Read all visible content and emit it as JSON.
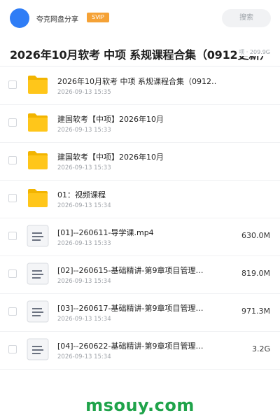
{
  "header": {
    "user_name": "夸克网盘分享",
    "vip_badge": "SVIP",
    "search_placeholder": "搜索"
  },
  "folder": {
    "title": "2026年10月软考 中项 系规课程合集（0912更新）",
    "meta": "项 · 209.9G"
  },
  "colors": {
    "folder": "#ffc61a",
    "accent": "#2f7df6",
    "vip": "#f5a236",
    "brand": "#1fa34a"
  },
  "items": [
    {
      "type": "folder",
      "icon": "folder-icon",
      "name": "2026年10月软考 中项 系规课程合集（0912…",
      "date": "2026-09-13 15:35",
      "size": ""
    },
    {
      "type": "folder",
      "icon": "folder-icon",
      "name": "建国软考【中项】2026年10月",
      "date": "2026-09-13 15:33",
      "size": ""
    },
    {
      "type": "folder",
      "icon": "folder-icon",
      "name": "建国软考【中项】2026年10月",
      "date": "2026-09-13 15:33",
      "size": ""
    },
    {
      "type": "folder",
      "icon": "folder-icon",
      "name": "01：视频课程",
      "date": "2026-09-13 15:34",
      "size": ""
    },
    {
      "type": "file",
      "icon": "document-icon",
      "name": "[01]--260611-导学课.mp4",
      "date": "2026-09-13 15:33",
      "size": "630.0M"
    },
    {
      "type": "file",
      "icon": "document-icon",
      "name": "[02]--260615-基础精讲-第9章项目管理…",
      "date": "2026-09-13 15:34",
      "size": "819.0M"
    },
    {
      "type": "file",
      "icon": "document-icon",
      "name": "[03]--260617-基础精讲-第9章项目管理…",
      "date": "2026-09-13 15:34",
      "size": "971.3M"
    },
    {
      "type": "file",
      "icon": "document-icon",
      "name": "[04]--260622-基础精讲-第9章项目管理…",
      "date": "2026-09-13 15:34",
      "size": "3.2G"
    }
  ],
  "watermark": "msouy.com"
}
